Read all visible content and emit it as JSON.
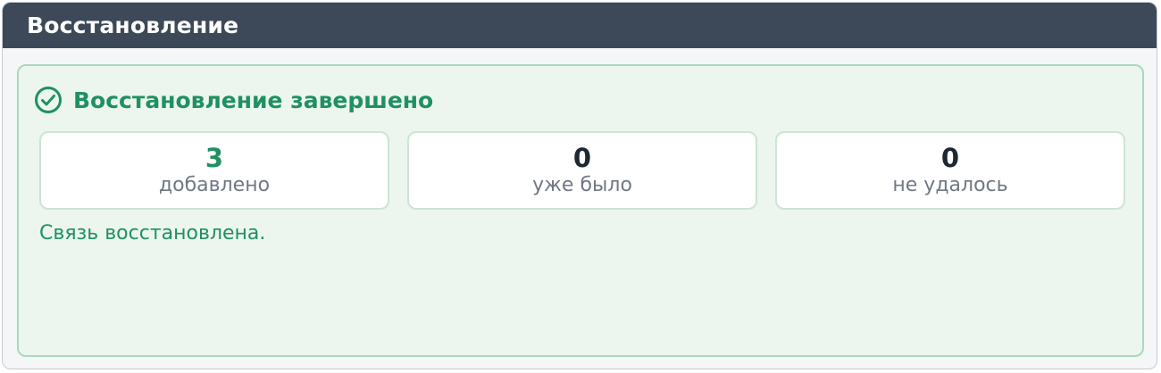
{
  "window": {
    "title": "Восстановление"
  },
  "result": {
    "status_icon": "check-circle-icon",
    "title": "Восстановление завершено",
    "stats": [
      {
        "value": "3",
        "label": "добавлено"
      },
      {
        "value": "0",
        "label": "уже было"
      },
      {
        "value": "0",
        "label": "не удалось"
      }
    ],
    "message": "Связь восстановлена."
  },
  "colors": {
    "titlebar": "#3d4958",
    "success": "#1f9160",
    "panel_background": "#ecf6ef",
    "panel_border": "#a9d9bd"
  }
}
